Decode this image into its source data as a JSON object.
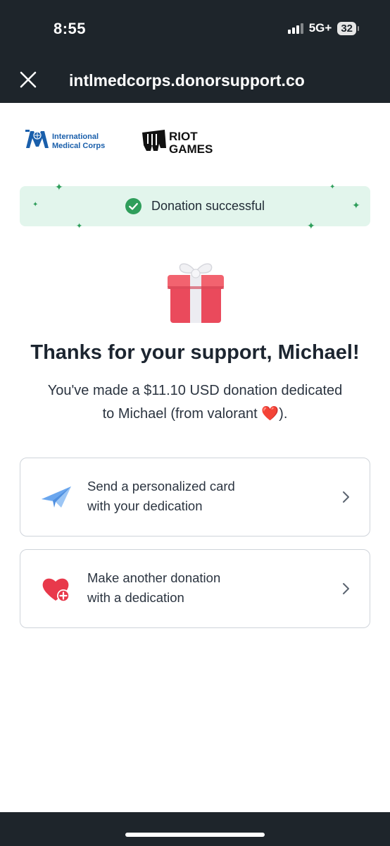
{
  "status_bar": {
    "time": "8:55",
    "network": "5G+",
    "battery": "32"
  },
  "header": {
    "url": "intlmedcorps.donorsupport.co"
  },
  "logos": {
    "imc": {
      "line1": "International",
      "line2": "Medical Corps",
      "color": "#1a5fab"
    },
    "riot": {
      "line1": "RIOT",
      "line2": "GAMES"
    }
  },
  "banner": {
    "text": "Donation successful",
    "background": "#e2f5ec",
    "accent": "#2f9e5b"
  },
  "main": {
    "title": "Thanks for your support, Michael!",
    "desc_line1": "You've made a $11.10 USD donation dedicated",
    "desc_line2": "to Michael (from valorant ",
    "desc_heart": "❤️",
    "desc_end": ")."
  },
  "actions": [
    {
      "line1": "Send a personalized card",
      "line2": "with your dedication",
      "icon": "paper-plane-icon"
    },
    {
      "line1": "Make another donation",
      "line2": "with a dedication",
      "icon": "heart-plus-icon"
    }
  ]
}
